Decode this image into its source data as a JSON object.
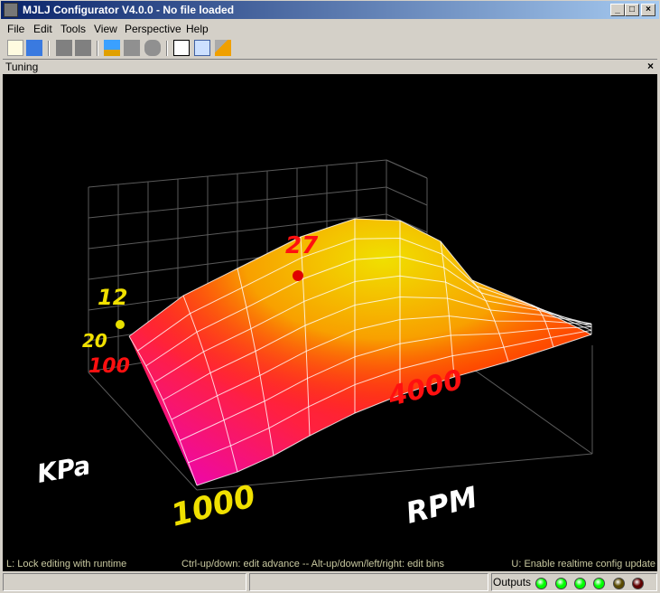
{
  "window": {
    "title": "MJLJ Configurator V4.0.0 - No file loaded",
    "controls": [
      "_",
      "□",
      "×"
    ]
  },
  "menu": [
    "File",
    "Edit",
    "Tools",
    "View",
    "Perspective",
    "Help"
  ],
  "toolbar": [
    "new-file-icon",
    "open-file-icon",
    "save-icon",
    "save-as-icon",
    "upload-icon",
    "download-icon",
    "chip-icon",
    "clipboard-edit-icon",
    "chart-icon",
    "wrench-icon"
  ],
  "panel": {
    "title": "Tuning",
    "close": "×"
  },
  "plot": {
    "rpm_label": "RPM",
    "kpa_label": "KPa",
    "rpm_min": "1000",
    "rpm_marker": "4000",
    "kpa_min": "100",
    "kpa_marker": "20",
    "cursor_value_left": "12",
    "cursor_value_top": "27",
    "colors": {
      "low": "#e800c8",
      "mid": "#ff2000",
      "high": "#f0e000"
    }
  },
  "hints": {
    "left": "L: Lock editing with runtime",
    "center": "Ctrl-up/down: edit advance -- Alt-up/down/left/right: edit bins",
    "right": "U: Enable realtime config update"
  },
  "status": {
    "outputs_label": "Outputs",
    "leds": [
      "#00ff00",
      "#00ff00",
      "#00ff00",
      "#00ff00",
      "#5a4a00",
      "#600000"
    ]
  }
}
